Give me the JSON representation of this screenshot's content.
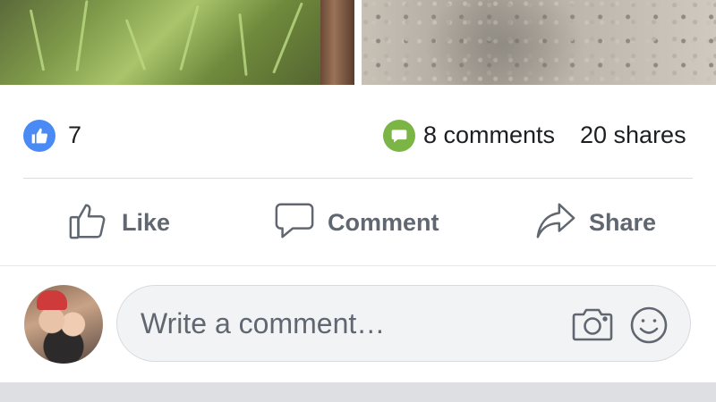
{
  "reactions": {
    "like_count": "7",
    "comments": "8 comments",
    "shares": "20 shares"
  },
  "actions": {
    "like_label": "Like",
    "comment_label": "Comment",
    "share_label": "Share"
  },
  "composer": {
    "placeholder": "Write a comment…"
  },
  "colors": {
    "like_badge": "#4a8af4",
    "comment_badge": "#7ab545",
    "action_text": "#606770"
  },
  "icons": [
    "thumbs-up-icon",
    "comment-bubble-icon",
    "share-arrow-icon",
    "camera-icon",
    "smiley-icon"
  ]
}
